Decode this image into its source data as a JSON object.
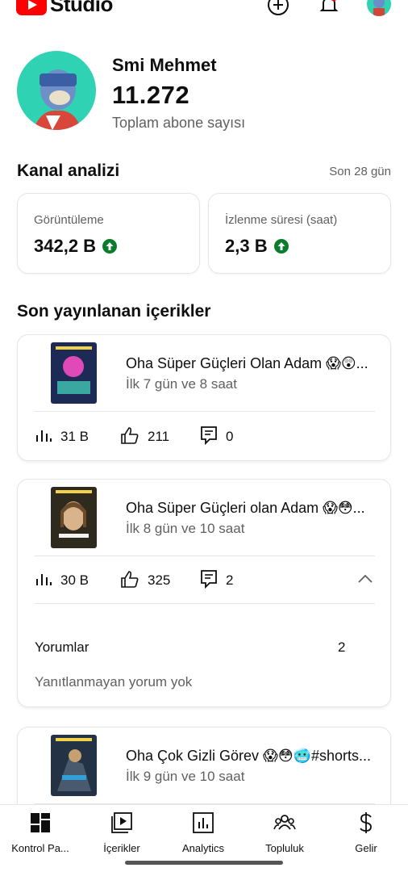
{
  "header": {
    "logo_text": "Studio",
    "icons": [
      "plus-circle-icon",
      "bell-icon",
      "avatar"
    ],
    "brand_color": "#ff0000"
  },
  "profile": {
    "name": "Smi Mehmet",
    "subscriber_count": "11.272",
    "subscriber_label": "Toplam abone sayısı"
  },
  "analytics": {
    "title": "Kanal analizi",
    "period": "Son 28 gün",
    "cards": [
      {
        "label": "Görüntüleme",
        "value": "342,2 B",
        "trend": "up"
      },
      {
        "label": "İzlenme süresi (saat)",
        "value": "2,3 B",
        "trend": "up"
      }
    ],
    "trend_color": "#0a7d2c"
  },
  "recent": {
    "title": "Son yayınlanan içerikler",
    "items": [
      {
        "title": "Oha Süper Güçleri Olan Adam 😱😲...",
        "subtitle": "İlk 7 gün ve 8 saat",
        "views": "31 B",
        "likes": "211",
        "comments": "0"
      },
      {
        "title": "Oha Süper Güçleri olan Adam 😱😳...",
        "subtitle": "İlk 8 gün ve 10 saat",
        "views": "30 B",
        "likes": "325",
        "comments": "2",
        "expanded": true,
        "comments_label": "Yorumlar",
        "comments_count": "2",
        "unanswered": "Yanıtlanmayan yorum yok"
      },
      {
        "title": "Oha Çok Gizli Görev 😱😳🥶#shorts...",
        "subtitle": "İlk 9 gün ve 10 saat"
      }
    ]
  },
  "nav": {
    "items": [
      {
        "label": "Kontrol Pa...",
        "icon": "dashboard-icon"
      },
      {
        "label": "İçerikler",
        "icon": "content-icon"
      },
      {
        "label": "Analytics",
        "icon": "analytics-icon"
      },
      {
        "label": "Topluluk",
        "icon": "community-icon"
      },
      {
        "label": "Gelir",
        "icon": "dollar-icon"
      }
    ]
  }
}
